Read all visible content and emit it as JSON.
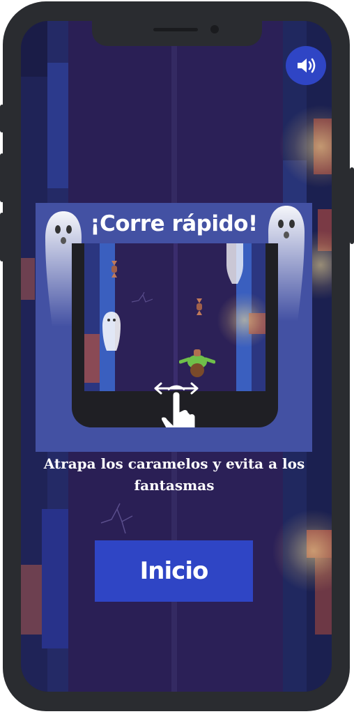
{
  "game": {
    "title": "¡Corre rápido!",
    "instruction": "Atrapa los caramelos y evita a los fantasmas",
    "start_label": "Inicio"
  },
  "icons": {
    "sound": "speaker-volume-icon",
    "gesture": "swipe-hand-icon",
    "ghost": "ghost-icon",
    "candy": "candy-icon",
    "player": "player-character-icon"
  },
  "colors": {
    "primary_button": "#2f45c5",
    "card": "#4351a3",
    "background": "#241c4a",
    "frame": "#2a2c30"
  }
}
